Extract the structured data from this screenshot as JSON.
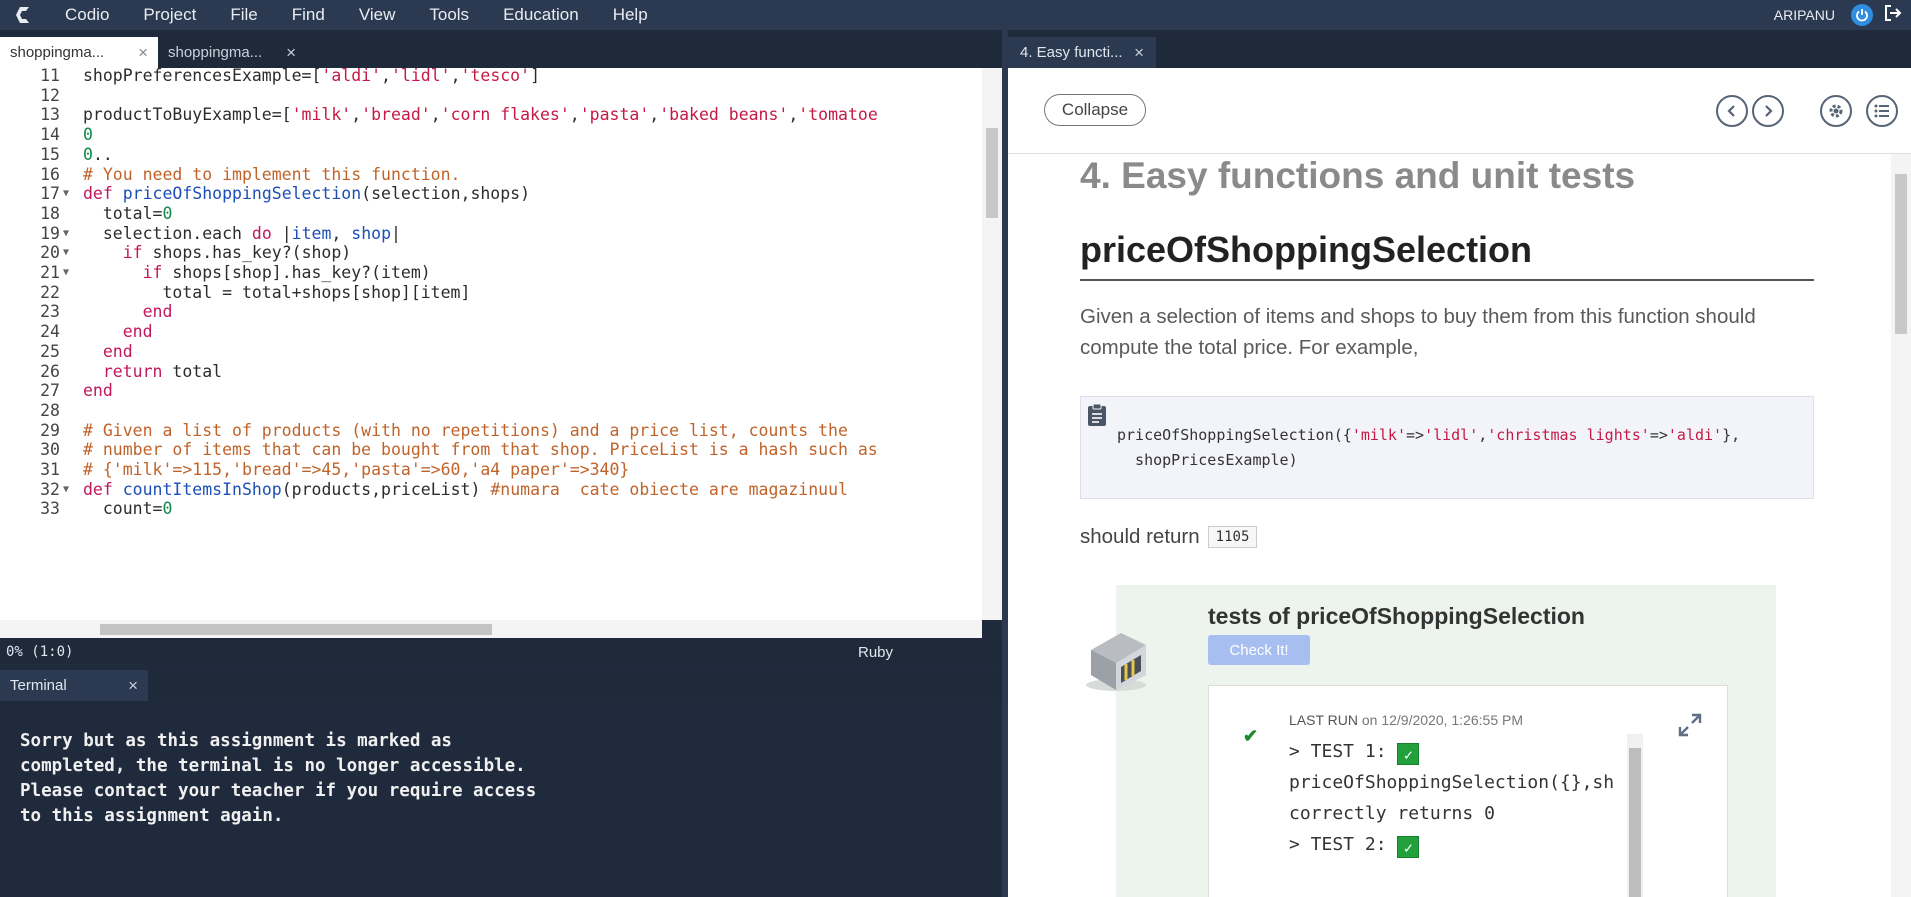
{
  "menubar": {
    "items": [
      "Codio",
      "Project",
      "File",
      "Find",
      "View",
      "Tools",
      "Education",
      "Help"
    ],
    "username": "ARIPANU"
  },
  "editor": {
    "tabs": [
      {
        "label": "shoppingma...",
        "close": "×"
      },
      {
        "label": "shoppingma...",
        "close": "×"
      }
    ],
    "lines": [
      {
        "n": "11",
        "fold": "",
        "tokens": [
          [
            "",
            "shopPreferencesExample=["
          ],
          [
            "str",
            "'aldi'"
          ],
          [
            "",
            ","
          ],
          [
            "str",
            "'lidl'"
          ],
          [
            "",
            ","
          ],
          [
            "str",
            "'tesco'"
          ],
          [
            "",
            "]"
          ]
        ]
      },
      {
        "n": "12",
        "fold": "",
        "tokens": [
          [
            "",
            ""
          ]
        ]
      },
      {
        "n": "13",
        "fold": "",
        "tokens": [
          [
            "",
            "productToBuyExample=["
          ],
          [
            "str",
            "'milk'"
          ],
          [
            "",
            ","
          ],
          [
            "str",
            "'bread'"
          ],
          [
            "",
            ","
          ],
          [
            "str",
            "'corn flakes'"
          ],
          [
            "",
            ","
          ],
          [
            "str",
            "'pasta'"
          ],
          [
            "",
            ","
          ],
          [
            "str",
            "'baked beans'"
          ],
          [
            "",
            ","
          ],
          [
            "str",
            "'tomatoe"
          ]
        ]
      },
      {
        "n": "14",
        "fold": "",
        "tokens": [
          [
            "num",
            "0"
          ]
        ]
      },
      {
        "n": "15",
        "fold": "",
        "tokens": [
          [
            "num",
            "0"
          ],
          [
            "",
            ".."
          ]
        ]
      },
      {
        "n": "16",
        "fold": "",
        "tokens": [
          [
            "cm",
            "# You need to implement this function."
          ]
        ]
      },
      {
        "n": "17",
        "fold": "▼",
        "tokens": [
          [
            "kw",
            "def "
          ],
          [
            "fn",
            "priceOfShoppingSelection"
          ],
          [
            "",
            "(selection,shops)"
          ]
        ]
      },
      {
        "n": "18",
        "fold": "",
        "tokens": [
          [
            "",
            "  total="
          ],
          [
            "num",
            "0"
          ]
        ]
      },
      {
        "n": "19",
        "fold": "▼",
        "tokens": [
          [
            "",
            "  selection.each "
          ],
          [
            "kw",
            "do"
          ],
          [
            "",
            " |"
          ],
          [
            "var",
            "item"
          ],
          [
            "",
            ", "
          ],
          [
            "var",
            "shop"
          ],
          [
            "",
            "|"
          ]
        ]
      },
      {
        "n": "20",
        "fold": "▼",
        "tokens": [
          [
            "",
            "    "
          ],
          [
            "kw",
            "if"
          ],
          [
            "",
            " shops.has_key?(shop)"
          ]
        ]
      },
      {
        "n": "21",
        "fold": "▼",
        "tokens": [
          [
            "",
            "      "
          ],
          [
            "kw",
            "if"
          ],
          [
            "",
            " shops[shop].has_key?(item)"
          ]
        ]
      },
      {
        "n": "22",
        "fold": "",
        "tokens": [
          [
            "",
            "        total = total+shops[shop][item]"
          ]
        ]
      },
      {
        "n": "23",
        "fold": "",
        "tokens": [
          [
            "",
            "      "
          ],
          [
            "kw",
            "end"
          ]
        ]
      },
      {
        "n": "24",
        "fold": "",
        "tokens": [
          [
            "",
            "    "
          ],
          [
            "kw",
            "end"
          ]
        ]
      },
      {
        "n": "25",
        "fold": "",
        "tokens": [
          [
            "",
            "  "
          ],
          [
            "kw",
            "end"
          ]
        ]
      },
      {
        "n": "26",
        "fold": "",
        "tokens": [
          [
            "",
            "  "
          ],
          [
            "kw",
            "return"
          ],
          [
            "",
            " total"
          ]
        ]
      },
      {
        "n": "27",
        "fold": "",
        "tokens": [
          [
            "kw",
            "end"
          ]
        ]
      },
      {
        "n": "28",
        "fold": "",
        "tokens": [
          [
            "",
            ""
          ]
        ]
      },
      {
        "n": "29",
        "fold": "",
        "tokens": [
          [
            "cm",
            "# Given a list of products (with no repetitions) and a price list, counts the"
          ]
        ]
      },
      {
        "n": "30",
        "fold": "",
        "tokens": [
          [
            "cm",
            "# number of items that can be bought from that shop. PriceList is a hash such as"
          ]
        ]
      },
      {
        "n": "31",
        "fold": "",
        "tokens": [
          [
            "cm",
            "# {'milk'=>115,'bread'=>45,'pasta'=>60,'a4 paper'=>340}"
          ]
        ]
      },
      {
        "n": "32",
        "fold": "▼",
        "tokens": [
          [
            "kw",
            "def "
          ],
          [
            "fn",
            "countItemsInShop"
          ],
          [
            "",
            "(products,priceList) "
          ],
          [
            "cm",
            "#numara  cate obiecte are magazinuul"
          ]
        ]
      },
      {
        "n": "33",
        "fold": "",
        "tokens": [
          [
            "",
            "  count="
          ],
          [
            "num",
            "0"
          ]
        ]
      }
    ],
    "status": {
      "position": "0%  (1:0)",
      "language": "Ruby"
    }
  },
  "terminal": {
    "tab_label": "Terminal",
    "close": "×",
    "lines": [
      "Sorry but as this assignment is marked as",
      "completed, the terminal is no longer accessible.",
      "Please contact your teacher if you require access",
      "to this assignment again."
    ]
  },
  "guide": {
    "tab_label": "4. Easy functi...",
    "close": "×",
    "collapse_label": "Collapse",
    "section_title": "4. Easy functions and unit tests",
    "heading": "priceOfShoppingSelection",
    "paragraph": "Given a selection of items and shops to buy them from this function should compute the total price. For example,",
    "code_line1_tokens": [
      [
        "",
        "priceOfShoppingSelection({"
      ],
      [
        "str",
        "'milk'"
      ],
      [
        "",
        "=>"
      ],
      [
        "str",
        "'lidl'"
      ],
      [
        "",
        ","
      ],
      [
        "str",
        "'christmas lights'"
      ],
      [
        "",
        "=>"
      ],
      [
        "str",
        "'aldi'"
      ],
      [
        "",
        "},"
      ]
    ],
    "code_line2": "  shopPricesExample)",
    "should_return_text": "should return",
    "return_value": "1105",
    "test": {
      "title": "tests of priceOfShoppingSelection",
      "check_label": "Check It!",
      "last_run_label": "LAST RUN",
      "last_run_time": "on 12/9/2020, 1:26:55 PM",
      "result_lines": [
        "> TEST 1: ",
        "priceOfShoppingSelection({},sh",
        "correctly returns 0",
        "",
        "> TEST 2: "
      ]
    }
  },
  "colors": {
    "menubar_bg": "#2b3a51",
    "accent": "#2f8ee0",
    "check_green": "#22a03b"
  }
}
